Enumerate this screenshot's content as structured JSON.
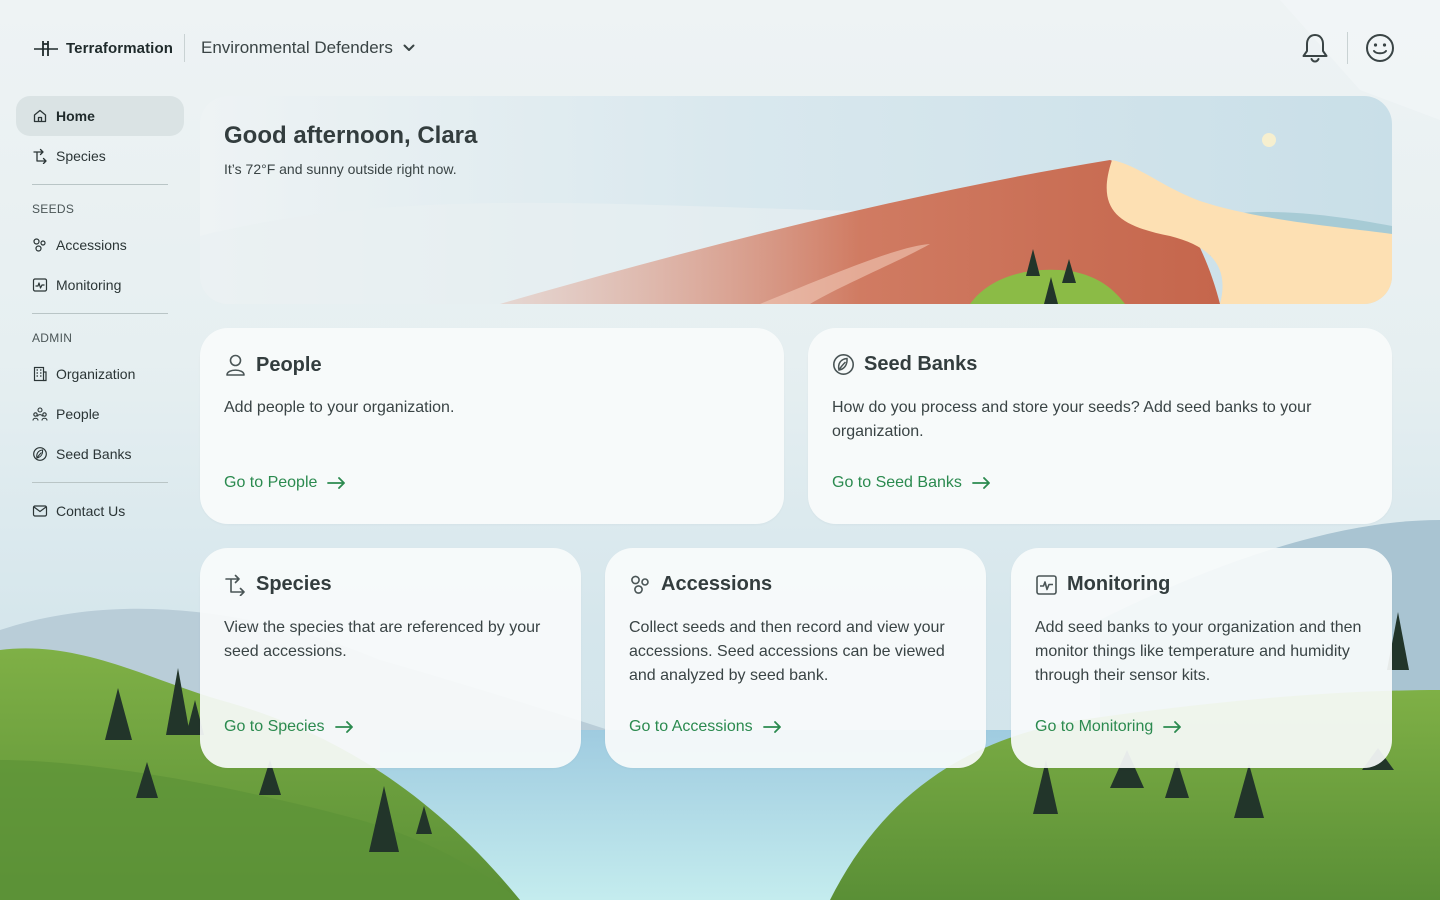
{
  "header": {
    "logo_text": "Terraformation",
    "org_name": "Environmental Defenders",
    "icons": {
      "logo": "terraformation-logo",
      "org_dropdown": "chevron-down-icon",
      "notifications": "bell-icon",
      "profile": "smiley-face-icon"
    }
  },
  "sidebar": {
    "items_top": [
      {
        "label": "Home",
        "icon": "home-icon",
        "active": true
      },
      {
        "label": "Species",
        "icon": "species-icon"
      }
    ],
    "seeds_section": "SEEDS",
    "items_seeds": [
      {
        "label": "Accessions",
        "icon": "accessions-icon"
      },
      {
        "label": "Monitoring",
        "icon": "monitoring-icon"
      }
    ],
    "admin_section": "ADMIN",
    "items_admin": [
      {
        "label": "Organization",
        "icon": "organization-icon"
      },
      {
        "label": "People",
        "icon": "people-icon"
      },
      {
        "label": "Seed Banks",
        "icon": "seed-bank-icon"
      }
    ],
    "items_bottom": [
      {
        "label": "Contact Us",
        "icon": "mail-icon"
      }
    ]
  },
  "hero": {
    "greeting": "Good afternoon, Clara",
    "weather": "It’s 72°F and sunny outside right now."
  },
  "cards": {
    "people": {
      "title": "People",
      "icon": "person-icon",
      "description": "Add people to your organization.",
      "link": "Go to People"
    },
    "seed_banks": {
      "title": "Seed Banks",
      "icon": "seed-bank-icon",
      "description": "How do you process and store your seeds? Add seed banks to your organization.",
      "link": "Go to Seed Banks"
    },
    "species": {
      "title": "Species",
      "icon": "species-icon",
      "description": "View the species that are referenced by your seed accessions.",
      "link": "Go to Species"
    },
    "accessions": {
      "title": "Accessions",
      "icon": "accessions-icon",
      "description": "Collect seeds and then record and view your accessions. Seed accessions can be viewed and analyzed by seed bank.",
      "link": "Go to Accessions"
    },
    "monitoring": {
      "title": "Monitoring",
      "icon": "monitoring-icon",
      "description": "Add seed banks to your organization and then monitor things like temperature and humidity through their sensor kits.",
      "link": "Go to Monitoring"
    }
  },
  "colors": {
    "accent_green": "#2b8a4f",
    "text": "#3a4445",
    "active_nav_bg": "#d7e0e1"
  }
}
